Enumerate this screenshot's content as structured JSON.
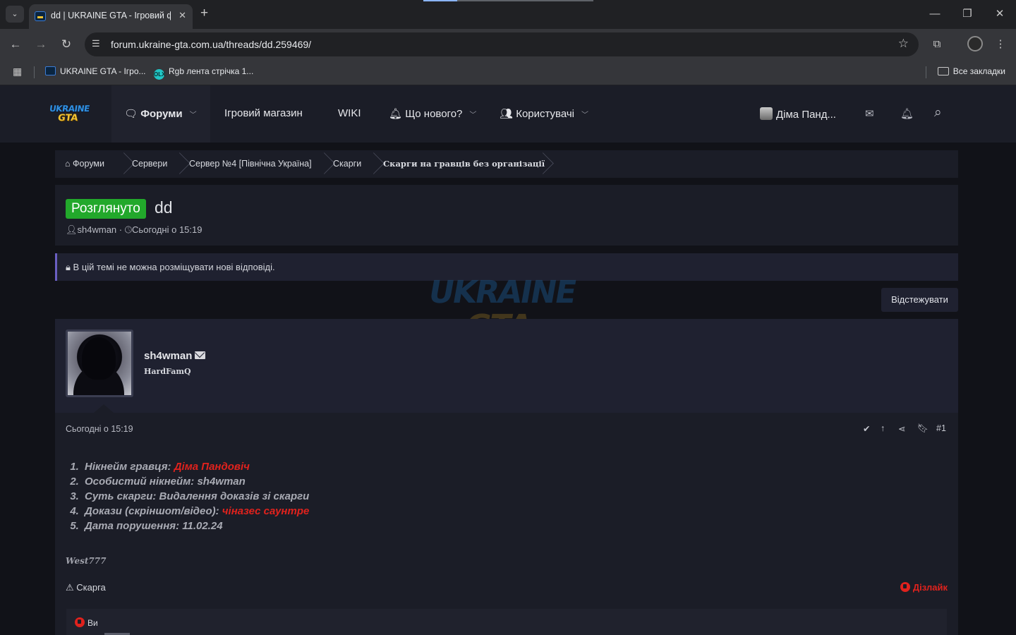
{
  "browser": {
    "tab_title": "dd | UKRAINE GTA - Ігровий ф",
    "tab_close": "✕",
    "new_tab": "+",
    "url": "forum.ukraine-gta.com.ua/threads/dd.259469/",
    "bookmarks": [
      {
        "label": "UKRAINE GTA - Ігро..."
      },
      {
        "label": "Rgb лента стрічка 1..."
      }
    ],
    "all_bookmarks": "Все закладки",
    "icons": {
      "tab_list": "chevron-down-icon",
      "back": "←",
      "forward": "→",
      "reload": "↻",
      "site_info": "☰",
      "star": "☆",
      "extensions": "⧉",
      "menu": "⋮",
      "minimize": "—",
      "maximize": "❐",
      "close": "✕",
      "apps": "▦"
    }
  },
  "header": {
    "logo_top": "UKRAINE",
    "logo_bottom": "GTA",
    "nav": [
      {
        "label": "Форуми",
        "icon": "🗨",
        "bold": true
      },
      {
        "label": "Ігровий магазин"
      },
      {
        "label": "WIKI"
      },
      {
        "label": "Що нового?",
        "icon": "🔔"
      },
      {
        "label": "Користувачі",
        "icon": "👥"
      }
    ],
    "user_name": "Діма Панд...",
    "icons": {
      "mail": "✉",
      "bell": "🔔",
      "search": "⌕"
    }
  },
  "breadcrumbs": [
    {
      "label": "Форуми",
      "icon": "⌂"
    },
    {
      "label": "Сервери"
    },
    {
      "label": "Сервер №4 [Північна Україна]"
    },
    {
      "label": "Скарги"
    },
    {
      "label": "Скарги на гравців без організації"
    }
  ],
  "thread": {
    "prefix": "Розглянуто",
    "title": "dd",
    "author": "sh4wman",
    "date": "Сьогодні о 15:19",
    "separator": "·"
  },
  "notice": {
    "text": "В цій темі не можна розміщувати нові відповіді."
  },
  "watermark": {
    "top": "UKRAINE",
    "bottom": "GTA"
  },
  "watch_button": "Відстежувати",
  "post": {
    "username": "sh4wman",
    "rank": "HardFamQ",
    "date": "Сьогодні о 15:19",
    "number": "#1",
    "items": [
      {
        "label": "Нікнейм гравця: ",
        "value": "Діма Пандовіч",
        "red": true
      },
      {
        "label": "Особистий нікнейм: sh4wman",
        "value": "",
        "red": false
      },
      {
        "label": "Суть скарги: Видалення доказів зі скарги",
        "value": "",
        "red": false
      },
      {
        "label": "Докази (скріншот/відео): ",
        "value": "чіназес саунтре",
        "red": true
      },
      {
        "label": "Дата порушення: 11.02.24",
        "value": "",
        "red": false
      }
    ],
    "signature": "West777",
    "report": "Скарга",
    "dislike": "Дізлайк",
    "reactions_text": "Ви"
  }
}
